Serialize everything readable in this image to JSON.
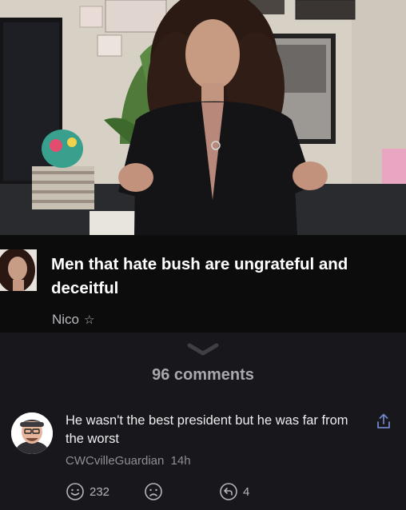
{
  "post": {
    "title": "Men that hate bush are ungrateful and deceitful",
    "author": "Nico",
    "author_badge_icon": "star-outline-icon"
  },
  "comments_section": {
    "count_label": "96 comments",
    "collapse_icon": "chevron-down-icon"
  },
  "comment": {
    "text": "He wasn't the best president but he was far from the worst",
    "username": "CWCvilleGuardian",
    "time": "14h",
    "likes": "232",
    "replies": "4",
    "share_icon": "share-icon",
    "like_icon": "smile-icon",
    "dislike_icon": "frown-icon",
    "reply_icon": "reply-icon"
  },
  "colors": {
    "background": "#18181c",
    "post_background": "#0c0c0d",
    "muted_text": "#8e8e95"
  }
}
